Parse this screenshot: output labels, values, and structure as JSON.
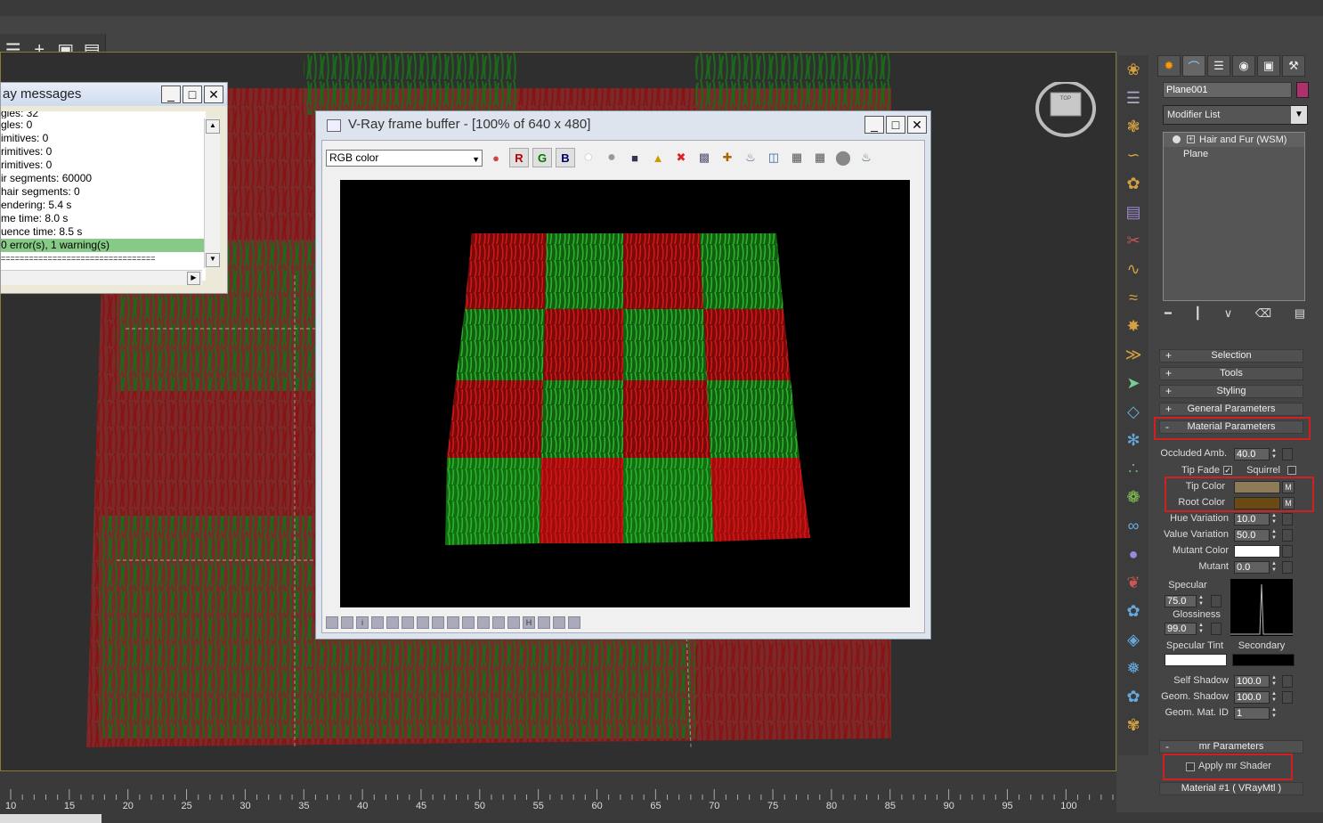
{
  "vray_messages": {
    "title": "ay messages",
    "lines": [
      "gles: 32",
      "gles: 0",
      "imitives: 0",
      "rimitives: 0",
      "rimitives: 0",
      "ir segments: 60000",
      "hair segments: 0",
      "endering: 5.4 s",
      "me time: 8.0 s",
      "uence time: 8.5 s",
      "0 error(s), 1 warning(s)",
      "================================="
    ]
  },
  "frame_buffer": {
    "title": "V-Ray frame buffer - [100% of 640 x 480]",
    "channel": "RGB color",
    "channel_buttons": [
      "R",
      "G",
      "B"
    ]
  },
  "command_panel": {
    "object_name": "Plane001",
    "object_color": "#b0306e",
    "modifier_list": "Modifier List",
    "stack": [
      {
        "label": "Hair and Fur (WSM)"
      },
      {
        "label": "Plane"
      }
    ],
    "rollouts": {
      "selection": "Selection",
      "tools": "Tools",
      "styling": "Styling",
      "general": "General Parameters",
      "material": "Material Parameters",
      "mr": "mr Parameters"
    },
    "material": {
      "occluded_amb_label": "Occluded Amb.",
      "occluded_amb": "40.0",
      "tip_fade_label": "Tip Fade",
      "squirrel_label": "Squirrel",
      "tip_color_label": "Tip Color",
      "tip_color": "#8d7b5a",
      "root_color_label": "Root Color",
      "root_color": "#6a4a10",
      "m_label": "M",
      "hue_variation_label": "Hue Variation",
      "hue_variation": "10.0",
      "value_variation_label": "Value Variation",
      "value_variation": "50.0",
      "mutant_color_label": "Mutant Color",
      "mutant_label": "Mutant",
      "mutant": "0.0",
      "specular_label": "Specular",
      "specular": "75.0",
      "glossiness_label": "Glossiness",
      "glossiness": "99.0",
      "specular_tint_label": "Specular Tint",
      "secondary_label": "Secondary",
      "self_shadow_label": "Self Shadow",
      "self_shadow": "100.0",
      "geom_shadow_label": "Geom. Shadow",
      "geom_shadow": "100.0",
      "geom_mat_id_label": "Geom. Mat. ID",
      "geom_mat_id": "1"
    },
    "mr": {
      "apply_label": "Apply mr Shader",
      "material_label": "Material #1  ( VRayMtl )"
    }
  },
  "timeline": {
    "ticks": [
      "10",
      "15",
      "20",
      "25",
      "30",
      "35",
      "40",
      "45",
      "50",
      "55",
      "60",
      "65",
      "70",
      "75",
      "80",
      "85",
      "90",
      "95",
      "100"
    ]
  },
  "viewcube_label": "TOP"
}
